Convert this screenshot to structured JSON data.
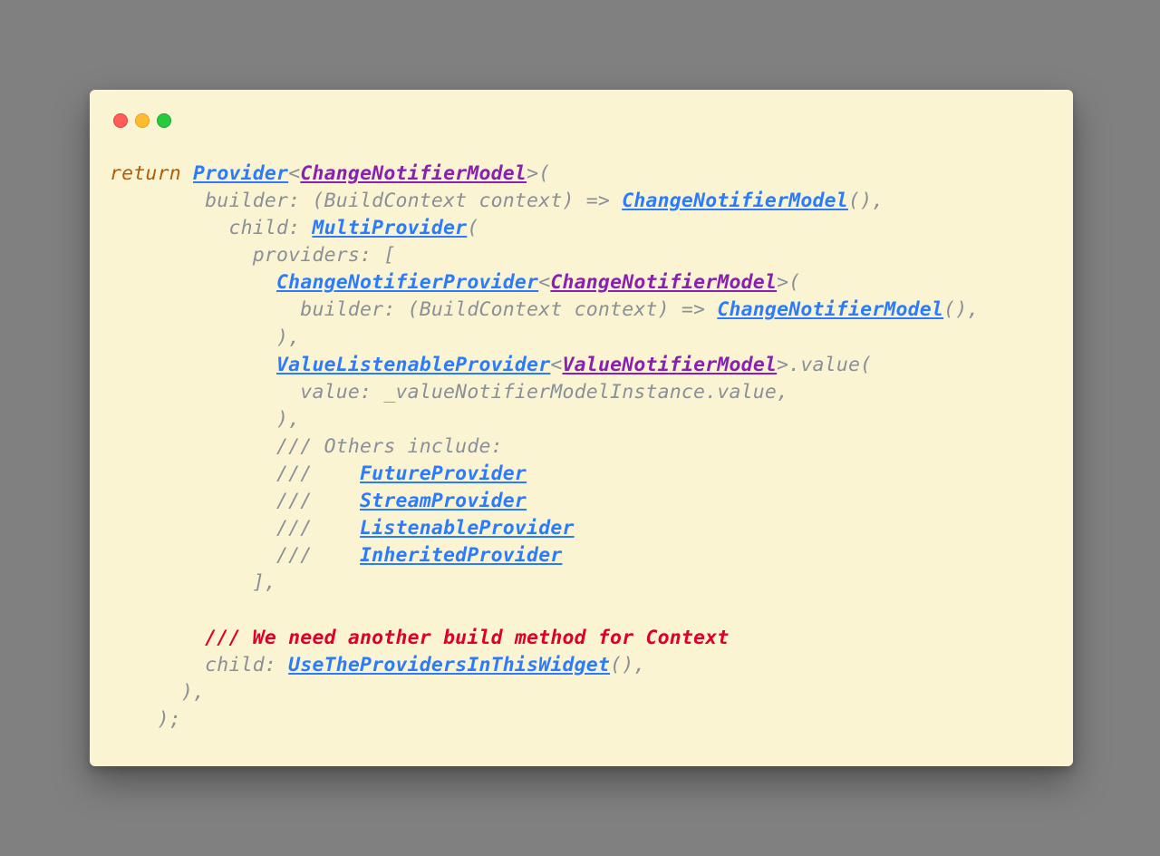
{
  "colors": {
    "bg_page": "#808080",
    "bg_window": "#faf4d3",
    "traffic_red": "#ff5f56",
    "traffic_yellow": "#ffbd2e",
    "traffic_green": "#27c93f",
    "keyword": "#b55b04",
    "link": "#2b7bff",
    "type": "#8a1fb0",
    "muted": "#8a8f98",
    "error": "#e00024"
  },
  "kw_return": "return",
  "provider": "Provider",
  "change_notifier_model": "ChangeNotifierModel",
  "lt": "<",
  "gt_open": ">(",
  "builder_line1": "        builder: (BuildContext context) => ",
  "cnm_call_close": "(),",
  "child_label": "          child: ",
  "multi_provider": "MultiProvider",
  "open_paren": "(",
  "providers_open": "            providers: [",
  "indent14": "              ",
  "change_notifier_provider": "ChangeNotifierProvider",
  "builder_line2": "                builder: (BuildContext context) => ",
  "close_paren_comma": "              ),",
  "value_listenable_provider": "ValueListenableProvider",
  "value_notifier_model": "ValueNotifierModel",
  "gt_value_open": ">.value(",
  "value_line": "                value: _valueNotifierModelInstance.value,",
  "comment_others": "              /// Others include:",
  "comment_prefix": "              ///    ",
  "future_provider": "FutureProvider",
  "stream_provider": "StreamProvider",
  "listenable_provider": "ListenableProvider",
  "inherited_provider": "InheritedProvider",
  "providers_close": "            ],",
  "error_comment": "        /// We need another build method for Context",
  "child2_label": "        child: ",
  "use_widget": "UseTheProvidersInThisWidget",
  "close_multi": "      ),",
  "close_return": "    );"
}
